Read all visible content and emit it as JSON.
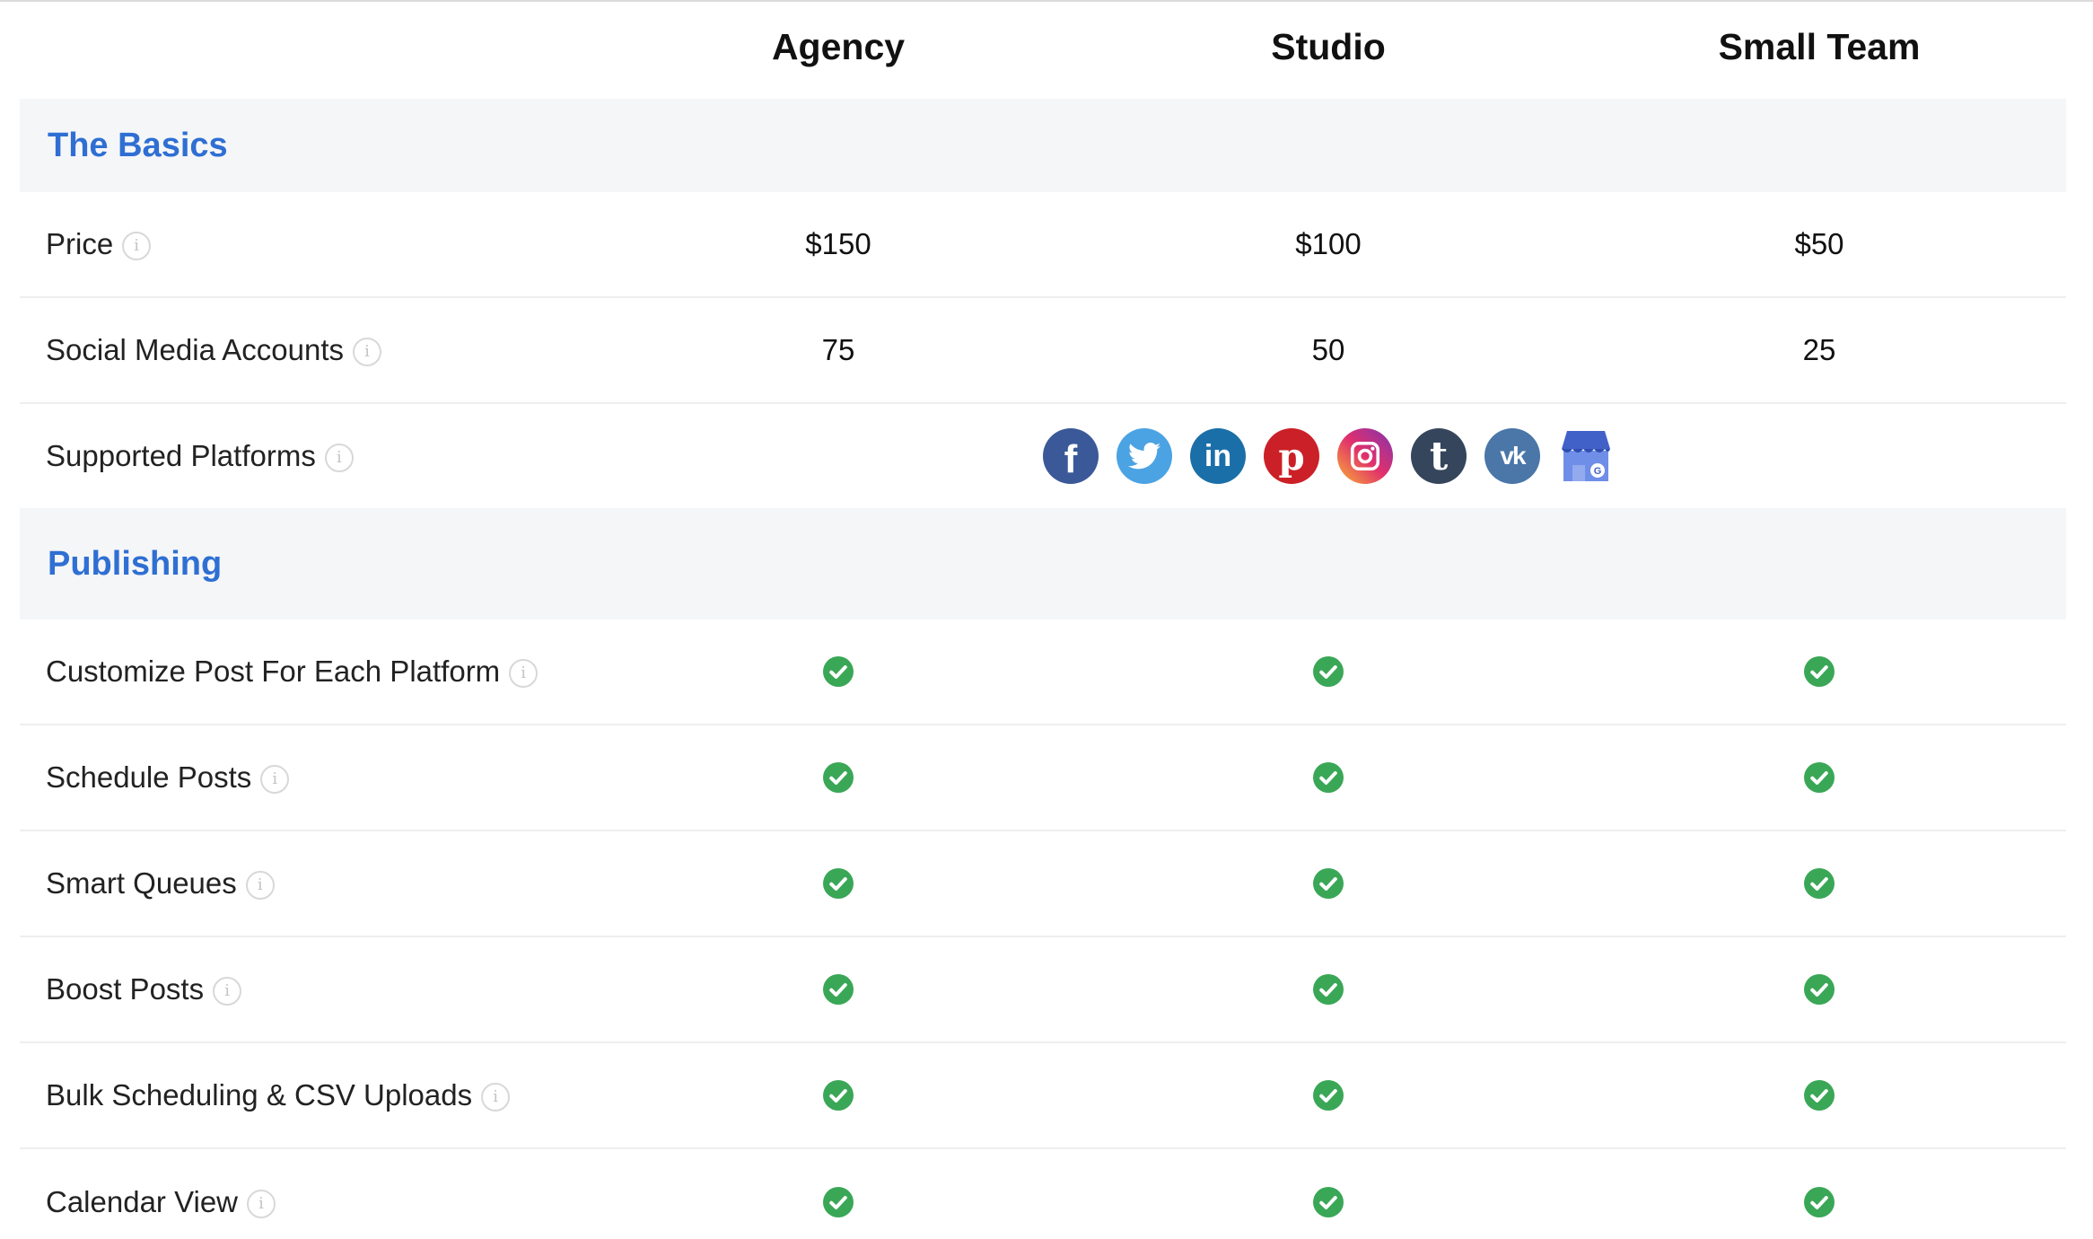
{
  "plans": {
    "agency": "Agency",
    "studio": "Studio",
    "small_team": "Small Team"
  },
  "info_glyph": "i",
  "sections": [
    {
      "title": "The Basics",
      "rows": [
        {
          "label": "Price",
          "agency": "$150",
          "studio": "$100",
          "small_team": "$50"
        },
        {
          "label": "Social Media Accounts",
          "agency": "75",
          "studio": "50",
          "small_team": "25"
        },
        {
          "label": "Supported Platforms",
          "platforms": [
            "facebook-icon",
            "twitter-icon",
            "linkedin-icon",
            "pinterest-icon",
            "instagram-icon",
            "tumblr-icon",
            "vk-icon",
            "google-my-business-icon"
          ]
        }
      ]
    },
    {
      "title": "Publishing",
      "rows": [
        {
          "label": "Customize Post For Each Platform",
          "agency": true,
          "studio": true,
          "small_team": true
        },
        {
          "label": "Schedule Posts",
          "agency": true,
          "studio": true,
          "small_team": true
        },
        {
          "label": "Smart Queues",
          "agency": true,
          "studio": true,
          "small_team": true
        },
        {
          "label": "Boost Posts",
          "agency": true,
          "studio": true,
          "small_team": true
        },
        {
          "label": "Bulk Scheduling & CSV Uploads",
          "agency": true,
          "studio": true,
          "small_team": true
        },
        {
          "label": "Calendar View",
          "agency": true,
          "studio": true,
          "small_team": true
        }
      ]
    }
  ],
  "colors": {
    "section_title": "#2f6fd3",
    "section_bg": "#f5f6f8",
    "check": "#3aa757"
  }
}
